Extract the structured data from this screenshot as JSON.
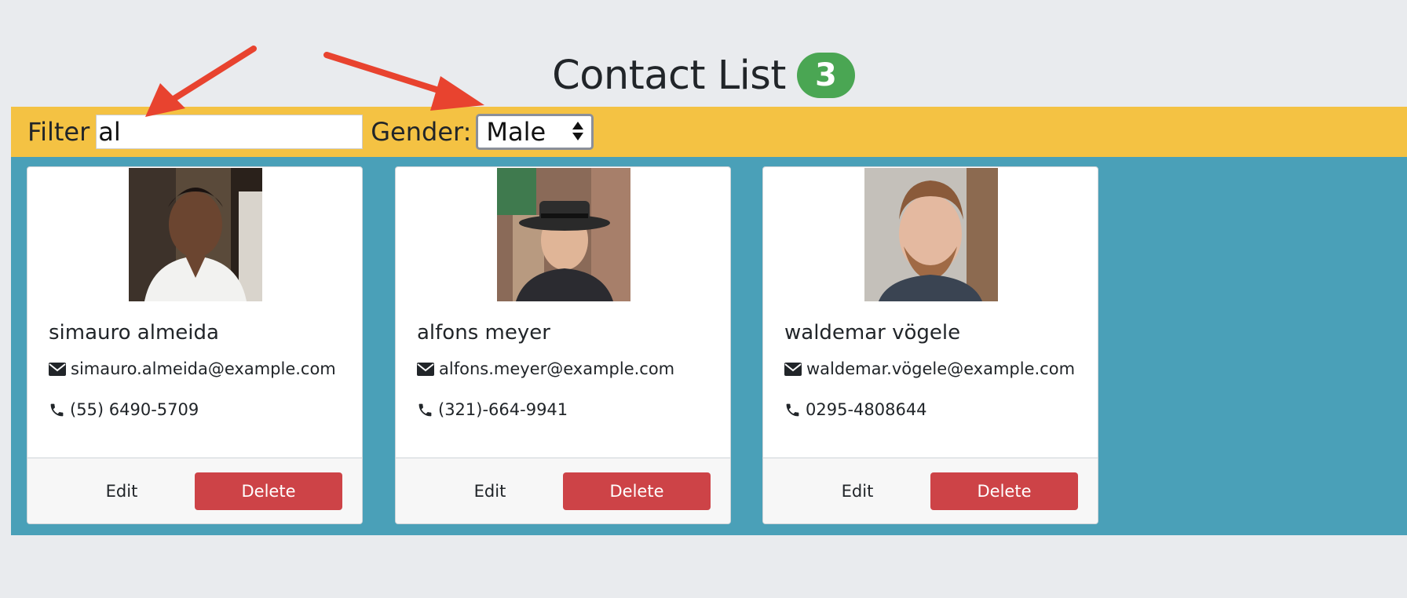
{
  "header": {
    "title": "Contact List",
    "count": "3"
  },
  "filter": {
    "label": "Filter",
    "value": "al",
    "gender_label": "Gender:",
    "gender_selected": "Male"
  },
  "contacts": [
    {
      "name": "simauro almeida",
      "email": "simauro.almeida@example.com",
      "phone": "(55) 6490-5709",
      "edit_label": "Edit",
      "delete_label": "Delete"
    },
    {
      "name": "alfons meyer",
      "email": "alfons.meyer@example.com",
      "phone": "(321)-664-9941",
      "edit_label": "Edit",
      "delete_label": "Delete"
    },
    {
      "name": "waldemar vögele",
      "email": "waldemar.vögele@example.com",
      "phone": "0295-4808644",
      "edit_label": "Edit",
      "delete_label": "Delete"
    }
  ],
  "colors": {
    "background": "#e9ebee",
    "badge": "#4aa653",
    "filter_bar": "#f4c243",
    "content_area": "#4aa0b8",
    "delete_button": "#cd4347",
    "annotation_arrow": "#e8432f"
  },
  "icons": {
    "email": "envelope-icon",
    "phone": "phone-icon",
    "select_arrows": "sort-arrows-icon"
  }
}
